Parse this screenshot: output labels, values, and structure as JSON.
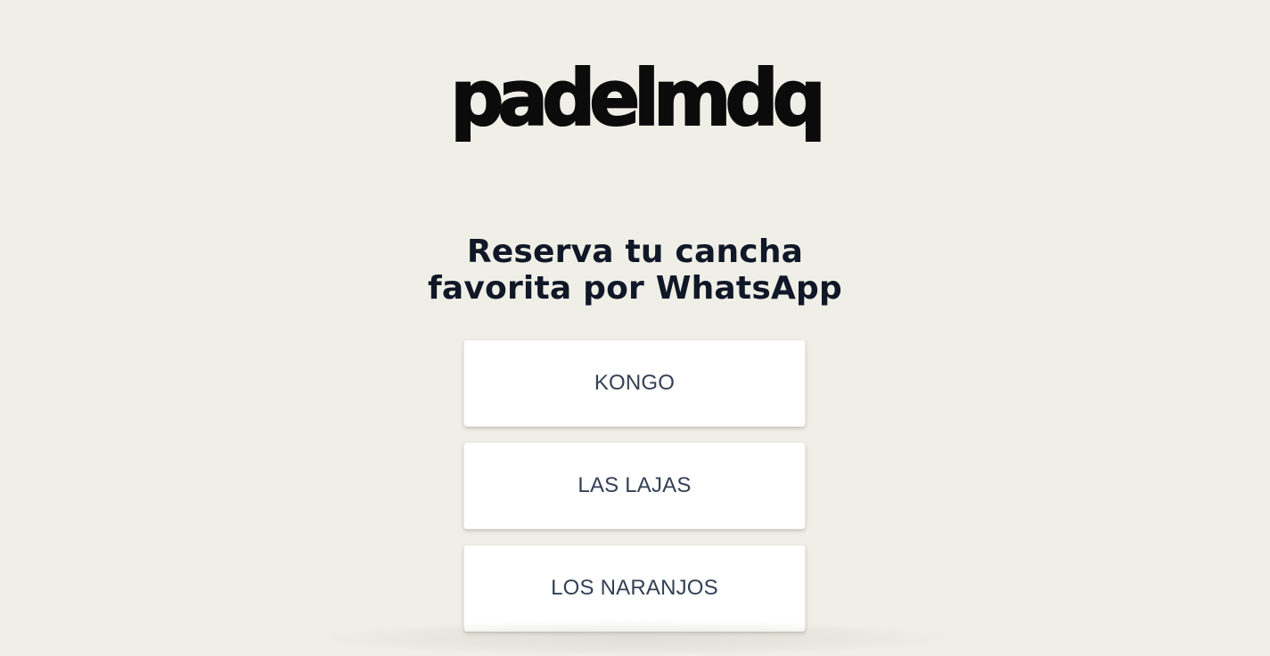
{
  "brand": {
    "logo_text": "padelmdq"
  },
  "headline": {
    "line1": "Reserva tu cancha",
    "line2": "favorita por WhatsApp"
  },
  "clubs": [
    {
      "label": "KONGO"
    },
    {
      "label": "LAS LAJAS"
    },
    {
      "label": "LOS NARANJOS"
    }
  ],
  "colors": {
    "background": "#f0efe7",
    "heading": "#101828",
    "button_text": "#344054",
    "button_bg": "#ffffff"
  }
}
